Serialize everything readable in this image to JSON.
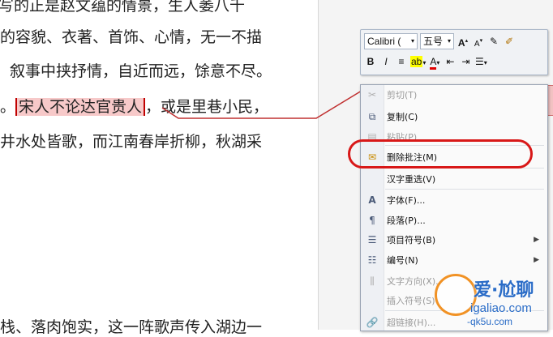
{
  "document": {
    "lines": [
      "写的正是赵文蕴的情景，生人萎八千",
      "的容貌、衣著、首饰、心情，无一不描",
      "叙事中挟抒情，自近而远，馀意不尽。",
      "。",
      "宋人不论达官贵人",
      "，或是里巷小民，",
      "井水处皆歌，而江南春岸折柳，秋湖采",
      "栈、落肉饱实，这一阵歌声传入湖边一"
    ]
  },
  "toolbar": {
    "font_name": "Calibri (",
    "font_size": "五号",
    "grow": "A",
    "shrink": "A",
    "bold": "B",
    "italic": "I",
    "align": "≡",
    "font_color": "A"
  },
  "context_menu": {
    "items": [
      {
        "label": "剪切(T)",
        "disabled": true
      },
      {
        "label": "复制(C)",
        "disabled": false
      },
      {
        "label": "粘贴(P)",
        "disabled": true
      },
      {
        "label": "删除批注(M)",
        "disabled": false
      },
      {
        "label": "汉字重选(V)",
        "disabled": false
      },
      {
        "label": "字体(F)...",
        "disabled": false
      },
      {
        "label": "段落(P)...",
        "disabled": false
      },
      {
        "label": "项目符号(B)",
        "disabled": false
      },
      {
        "label": "编号(N)",
        "disabled": false
      },
      {
        "label": "文字方向(X)...",
        "disabled": true
      },
      {
        "label": "插入符号(S)",
        "disabled": true
      },
      {
        "label": "超链接(H)...",
        "disabled": true
      }
    ]
  },
  "watermark": {
    "title": "爱·尬聊",
    "url": "igaliao.com",
    "footer": "-qk5u.com"
  },
  "colors": {
    "annotation": "#d81818",
    "highlight": "#f7c9c9",
    "watermark_blue": "#2a6cc7"
  }
}
